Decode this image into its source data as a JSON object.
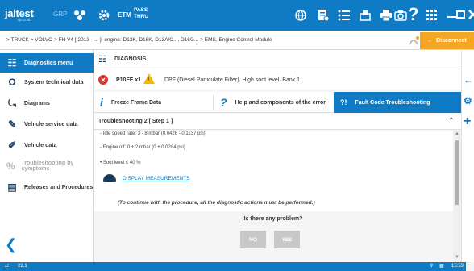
{
  "topbar": {
    "logo": "jaltest",
    "logo_sub": "by COJALI",
    "mode": "GRP",
    "etm_label": "ETM",
    "pass_label_1": "PASS",
    "pass_label_2": "THRU",
    "help_glyph": "?",
    "accent": "#0e7bc4"
  },
  "breadcrumb": {
    "text": "> TRUCK > VOLVO > FH V4 [ 2013 - ... ], engine: D13K, D16K, D13A/C..., D16G... > EMS, Engine Control Module"
  },
  "disconnect_label": "Disconnect",
  "sidebar": {
    "items": [
      {
        "label": "Diagnostics menu",
        "icon": "diagnostics-icon"
      },
      {
        "label": "System technical data",
        "icon": "ohm-icon"
      },
      {
        "label": "Diagrams",
        "icon": "diagram-icon"
      },
      {
        "label": "Vehicle service data",
        "icon": "service-icon"
      },
      {
        "label": "Vehicle data",
        "icon": "wrench-icon"
      },
      {
        "label": "Troubleshooting by symptoms",
        "icon": "troubleshooting-icon"
      },
      {
        "label": "Releases and Procedures",
        "icon": "procedures-icon"
      }
    ]
  },
  "diagnosis": {
    "title": "DIAGNOSIS",
    "error_code": "P10FE  x1",
    "error_desc": "DPF (Diesel Particulate Filter). High soot level. Bank 1.",
    "tabs": [
      {
        "label": "Freeze Frame Data",
        "glyph": "i"
      },
      {
        "label": "Help and components of the error",
        "glyph": "?"
      },
      {
        "label": "Fault Code Troubleshooting",
        "glyph": "?!"
      }
    ],
    "troubleshooting_title": "Troubleshooting 2 [ Step 1 ]",
    "lines": [
      "- Idle speed rate: 3 - 8 mbar (0.0426 - 0.1137 psi)",
      "- Engine off: 0 ± 2 mbar (0 ± 0.0284 psi)",
      "• Soot level ≤ 40 %"
    ],
    "display_measurements": "DISPLAY MEASUREMENTS",
    "note": "(To continue with the procedure, all the diagnostic actions must be performed.)",
    "question": "Is there any problem?",
    "no_label": "NO",
    "yes_label": "YES"
  },
  "statusbar": {
    "version": "22.1",
    "time": "15:53"
  }
}
